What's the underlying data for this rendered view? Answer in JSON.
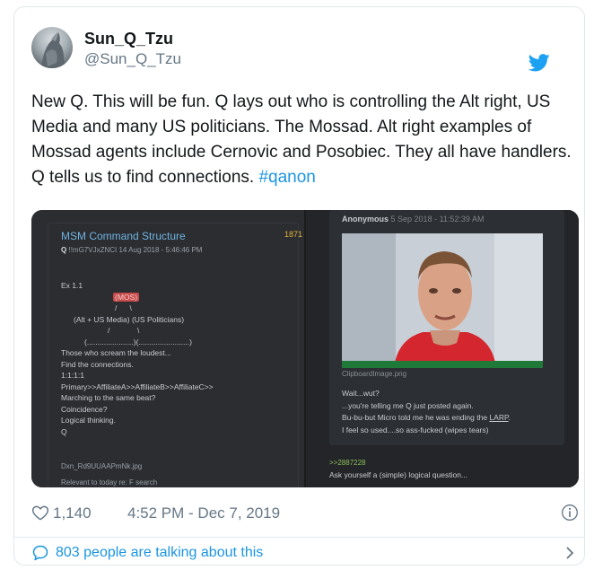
{
  "author": {
    "display_name": "Sun_Q_Tzu",
    "handle": "@Sun_Q_Tzu"
  },
  "tweet": {
    "text": "New Q. This will be fun.  Q lays out who is controlling the Alt right, US Media and many US politicians.   The Mossad.  Alt right examples of Mossad agents include Cernovic and Posobiec. They all have handlers. Q tells us to find connections. ",
    "hashtag": "#qanon"
  },
  "media": {
    "left": {
      "title": "MSM Command Structure",
      "post_number": "1871",
      "meta_name": "Q",
      "meta_trip": "!!mG7VJxZNCI",
      "meta_date": "14 Aug 2018 - 5:46:46 PM",
      "lines": [
        "Ex 1.1",
        "(MOS)",
        "/      \\",
        "(Alt + US Media) (US Politicians)",
        "/             \\",
        "(......................)(........................)",
        "Those who scream the loudest...",
        "Find the connections.",
        "1:1:1:1",
        "Primary>>AffiliateA>>AffiliateB>>AffiliateC>>",
        "Marching to the same beat?",
        "Coincidence?",
        "Logical thinking.",
        "Q"
      ],
      "filename": "Dxn_Rd9UUAAPmNk.jpg",
      "cut_text": "Relevant to today re: F search"
    },
    "right": {
      "anon_name": "Anonymous",
      "anon_date": "5 Sep 2018 - 11:52:39 AM",
      "filename": "ClipboardImage.png",
      "lines": [
        "Wait...wut?",
        "...you're telling me Q just posted again.",
        "Bu-bu-but Micro told me he was ending the ",
        "I feel so used....so ass-fucked (wipes tears)"
      ],
      "larp": "LARP",
      "larp_suffix": ".",
      "reply_link": ">>2887228",
      "question": "Ask yourself a (simple) logical question..."
    }
  },
  "stats": {
    "likes": "1,140",
    "timestamp": "4:52 PM - Dec 7, 2019"
  },
  "footer": {
    "talking": "803 people are talking about this"
  },
  "colors": {
    "twitter_blue": "#1b95e0",
    "text": "#14171a",
    "secondary": "#657786"
  },
  "icons": [
    "twitter-bird-icon",
    "heart-icon",
    "info-icon",
    "speech-bubble-icon",
    "chevron-right-icon"
  ]
}
